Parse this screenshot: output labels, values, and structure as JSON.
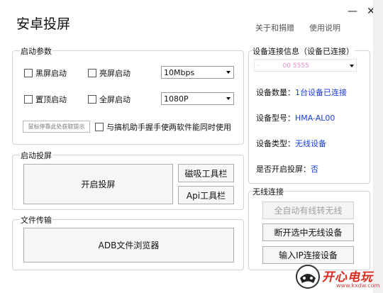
{
  "app": {
    "title": "安卓投屏"
  },
  "window": {
    "minimize_symbol": "—",
    "close_symbol": "✕"
  },
  "header": {
    "about_link": "关于和捐赠",
    "help_link": "使用说明"
  },
  "startup_params": {
    "title": "启动参数",
    "black_screen": "黑屏启动",
    "bright_screen": "亮屏启动",
    "bitrate": {
      "value": "10Mbps"
    },
    "pin_top": "置顶启动",
    "fullscreen": "全屏启动",
    "resolution": {
      "value": "1080P"
    },
    "hint_box": "鼠标停靠此处获取提示",
    "sync_option": "与搞机助手握手使两软件能同时使用"
  },
  "launch": {
    "title": "启动投屏",
    "start_button": "开启投屏",
    "magnet_toolbar": "磁吸工具栏",
    "api_toolbar": "Api工具栏"
  },
  "file_transfer": {
    "title": "文件传输",
    "adb_browser": "ADB文件浏览器"
  },
  "device_info": {
    "title": "设备连接信息（设备已连接）",
    "device_select": "· 　　　 00 5555",
    "count_label": "设备数量：",
    "count_value": "1台设备已连接",
    "model_label": "设备型号：",
    "model_value": "HMA-AL00",
    "type_label": "设备类型：",
    "type_value": "无线设备",
    "mirroring_label": "是否开启投屏：",
    "mirroring_value": "否"
  },
  "wireless": {
    "title": "无线连接",
    "auto_wireless": "全自动有线转无线",
    "disconnect_selected": "断开选中无线设备",
    "input_ip": "输入IP连接设备"
  },
  "watermark": {
    "brand": "开心电玩",
    "domain": "www.kxdw.com"
  },
  "colors": {
    "accent": "#1a3fd8",
    "border": "#d4d4d4",
    "watermark_red": "#d92b1e"
  }
}
